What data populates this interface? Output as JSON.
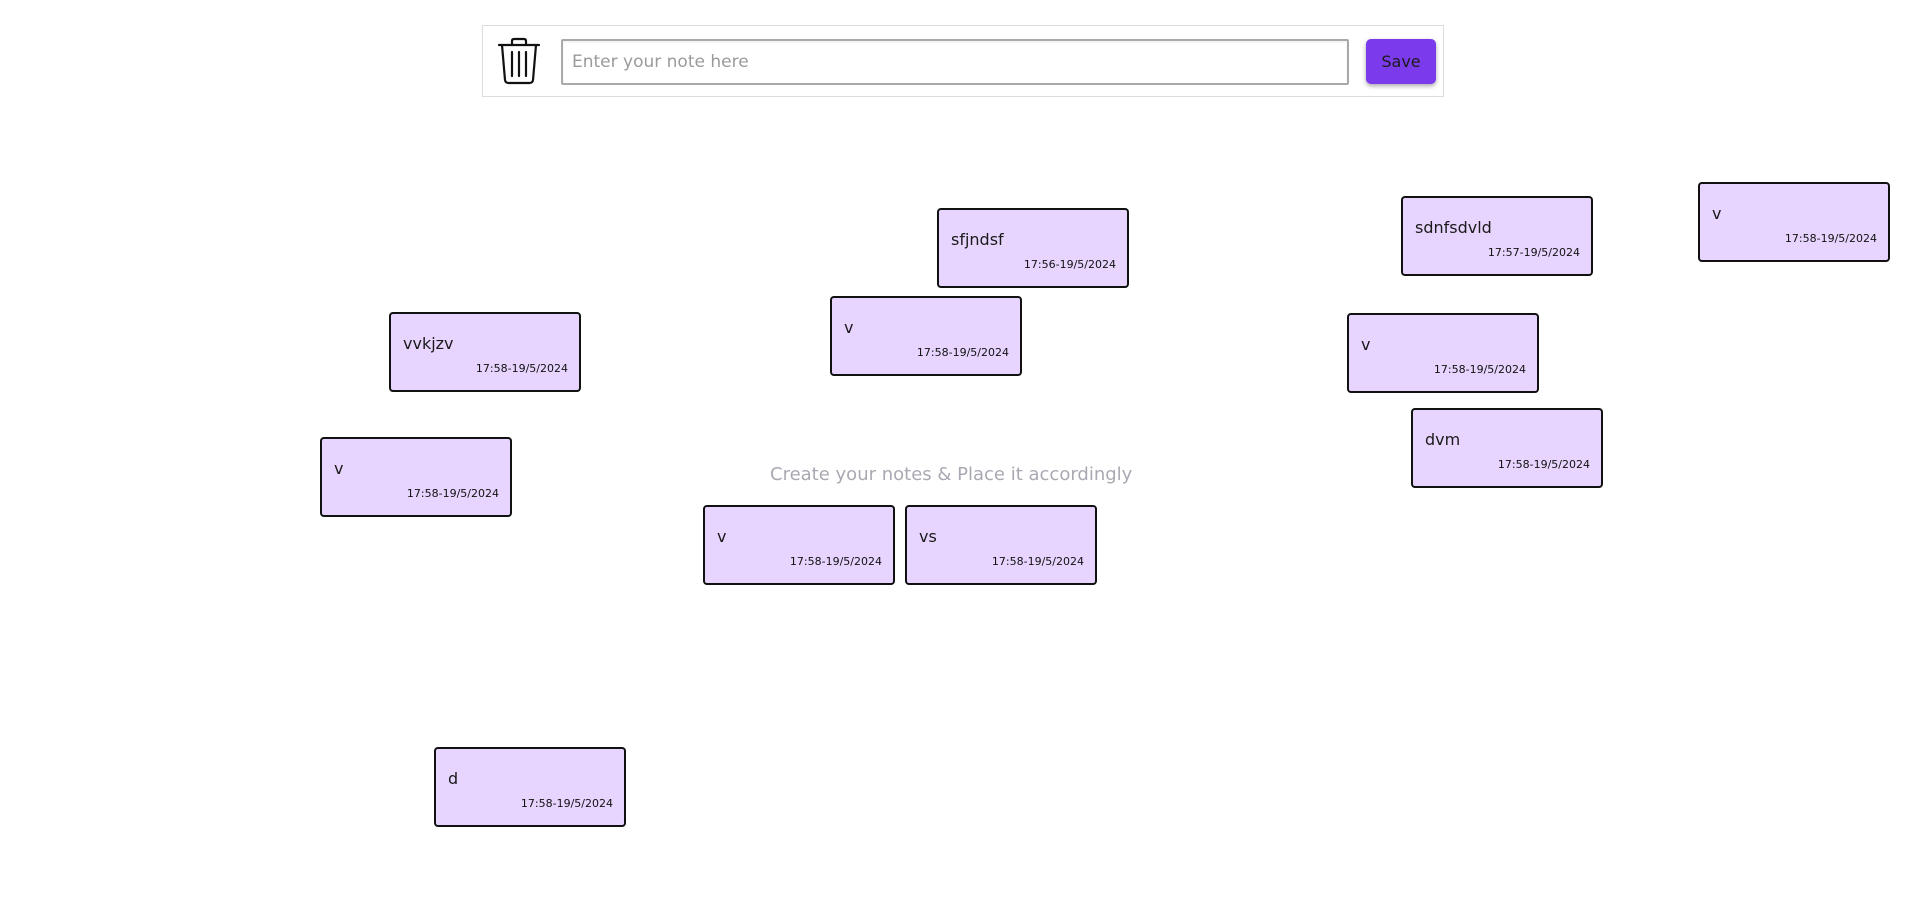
{
  "toolbar": {
    "input_placeholder": "Enter your note here",
    "input_value": "",
    "save_label": "Save"
  },
  "hint": "Create your notes & Place it accordingly",
  "colors": {
    "accent": "#7c3aed",
    "note_bg": "#e8d5ff",
    "note_border": "#111111"
  },
  "notes": [
    {
      "text": "sfjndsf",
      "time": "17:56-19/5/2024"
    },
    {
      "text": "sdnfsdvld",
      "time": "17:57-19/5/2024"
    },
    {
      "text": "v",
      "time": "17:58-19/5/2024"
    },
    {
      "text": "vvkjzv",
      "time": "17:58-19/5/2024"
    },
    {
      "text": "v",
      "time": "17:58-19/5/2024"
    },
    {
      "text": "v",
      "time": "17:58-19/5/2024"
    },
    {
      "text": "dvm",
      "time": "17:58-19/5/2024"
    },
    {
      "text": "v",
      "time": "17:58-19/5/2024"
    },
    {
      "text": "v",
      "time": "17:58-19/5/2024"
    },
    {
      "text": "vs",
      "time": "17:58-19/5/2024"
    },
    {
      "text": "d",
      "time": "17:58-19/5/2024"
    }
  ]
}
